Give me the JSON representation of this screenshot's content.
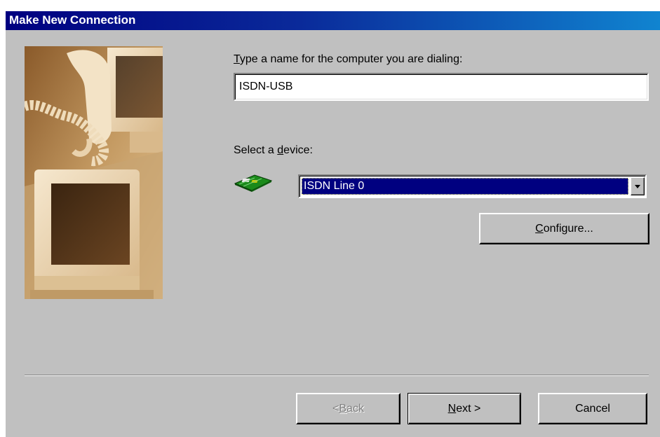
{
  "window": {
    "title": "Make New Connection",
    "title_color": "#000080",
    "face_color": "#c0c0c0"
  },
  "illustration": {
    "icon": "computer-phone-illustration",
    "tint": "#b38a52"
  },
  "name_field": {
    "label_mnemonic": "T",
    "label_rest": "ype a name for the computer you are dialing:",
    "value": "ISDN-USB"
  },
  "device": {
    "label_pre": "Select a ",
    "label_mnemonic": "d",
    "label_post": "evice:",
    "icon": "network-adapter-icon",
    "selected": "ISDN Line 0",
    "configure_mnemonic": "C",
    "configure_rest": "onfigure..."
  },
  "buttons": {
    "back_pre": "< ",
    "back_mnemonic": "B",
    "back_rest": "ack",
    "next_mnemonic": "N",
    "next_rest": "ext >",
    "cancel": "Cancel"
  }
}
